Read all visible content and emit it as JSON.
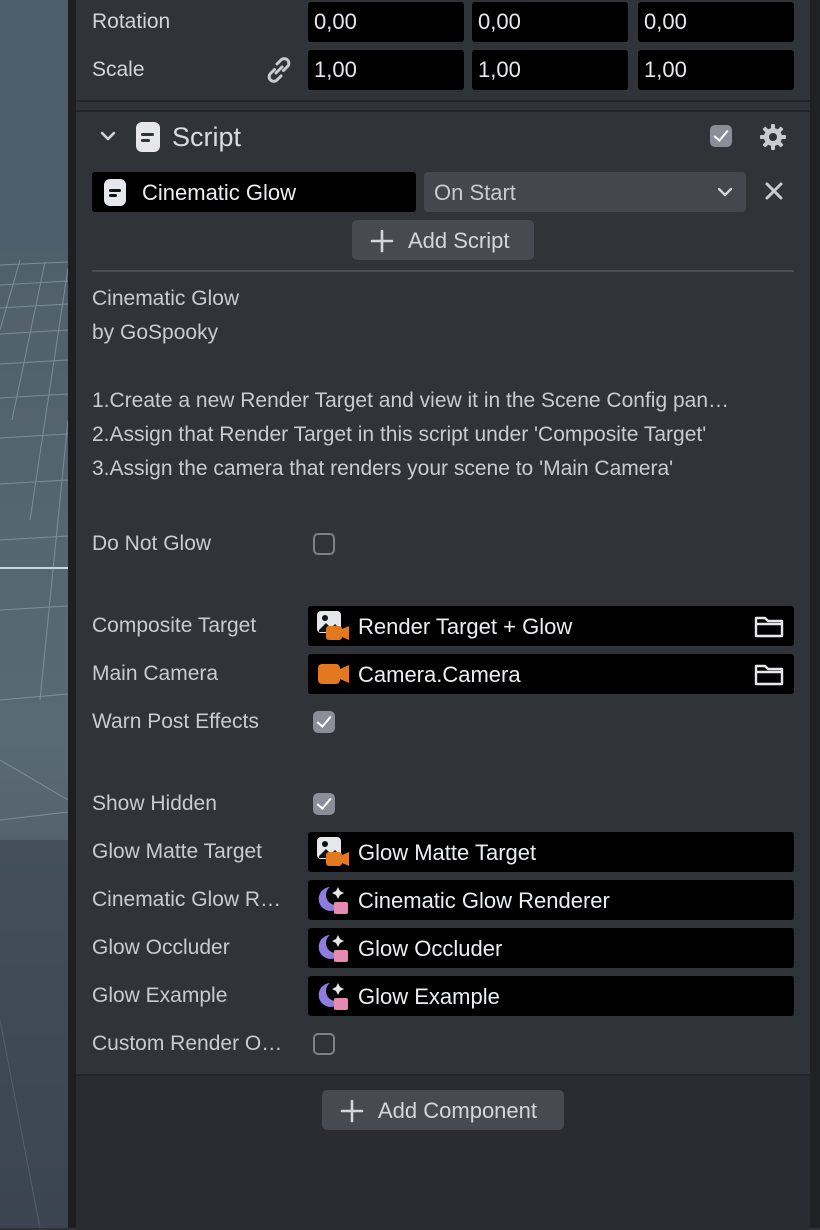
{
  "transform": {
    "rotation_label": "Rotation",
    "rotation_values": [
      "0,00",
      "0,00",
      "0,00"
    ],
    "scale_label": "Scale",
    "scale_values": [
      "1,00",
      "1,00",
      "1,00"
    ]
  },
  "script_component": {
    "title": "Script",
    "enabled": true,
    "script_name": "Cinematic Glow",
    "trigger": "On Start",
    "add_script_label": "Add Script",
    "description": {
      "line1": "Cinematic Glow",
      "line2": "by GoSpooky",
      "step1": "1.Create a new Render Target and view it in the Scene Config pan…",
      "step2": "2.Assign that Render Target in this script under 'Composite Target'",
      "step3": "3.Assign the camera that renders your scene to 'Main Camera'"
    },
    "properties": {
      "do_not_glow": {
        "label": "Do Not Glow",
        "checked": false
      },
      "composite_target": {
        "label": "Composite Target",
        "value": "Render Target + Glow",
        "icon": "render-target-icon"
      },
      "main_camera": {
        "label": "Main Camera",
        "value": "Camera.Camera",
        "icon": "camera-icon"
      },
      "warn_post_effects": {
        "label": "Warn Post Effects",
        "checked": true
      },
      "show_hidden": {
        "label": "Show Hidden",
        "checked": true
      },
      "glow_matte_target": {
        "label": "Glow Matte Target",
        "value": "Glow Matte Target",
        "icon": "render-target-icon"
      },
      "cinematic_glow_renderer": {
        "label": "Cinematic Glow R…",
        "value": "Cinematic Glow Renderer",
        "icon": "material-icon"
      },
      "glow_occluder": {
        "label": "Glow Occluder",
        "value": "Glow Occluder",
        "icon": "material-icon"
      },
      "glow_example": {
        "label": "Glow Example",
        "value": "Glow Example",
        "icon": "material-icon"
      },
      "custom_render_order": {
        "label": "Custom Render O…",
        "checked": false
      }
    }
  },
  "footer": {
    "add_component_label": "Add Component"
  },
  "colors": {
    "panel_bg": "#303338",
    "field_bg": "#000000",
    "camera_orange": "#e2781f",
    "material_purple": "#8c7be0",
    "material_pink": "#e58ab0"
  }
}
